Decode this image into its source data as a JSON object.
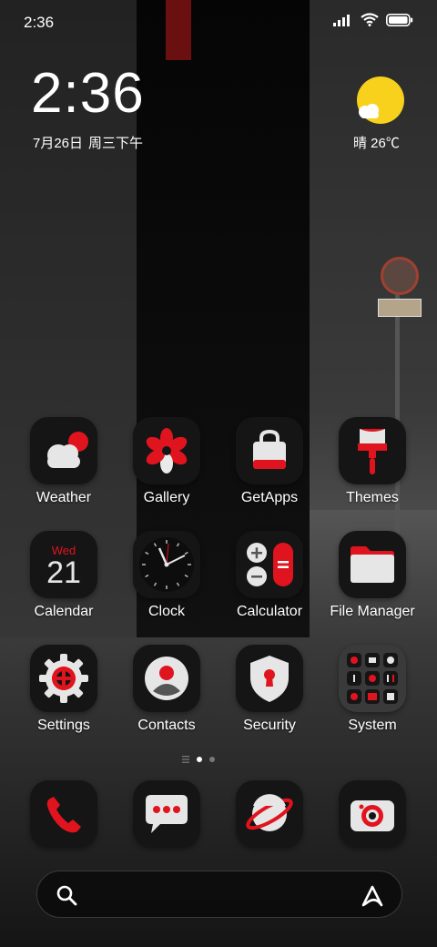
{
  "status_bar": {
    "time": "2:36"
  },
  "clock_widget": {
    "time": "2:36",
    "date": "7月26日",
    "weekday_period": "周三下午"
  },
  "weather_widget": {
    "text": "晴 26℃",
    "icon": "sunny-partly-cloudy-icon"
  },
  "apps": [
    {
      "label": "Weather",
      "icon": "weather-cloud-icon"
    },
    {
      "label": "Gallery",
      "icon": "gallery-flower-icon"
    },
    {
      "label": "GetApps",
      "icon": "shopping-bag-icon"
    },
    {
      "label": "Themes",
      "icon": "paint-brush-icon"
    },
    {
      "label": "Calendar",
      "icon": "calendar-icon",
      "badge_day": "Wed",
      "badge_date": "21"
    },
    {
      "label": "Clock",
      "icon": "clock-icon"
    },
    {
      "label": "Calculator",
      "icon": "calculator-icon"
    },
    {
      "label": "File Manager",
      "icon": "folder-icon"
    },
    {
      "label": "Settings",
      "icon": "gear-icon"
    },
    {
      "label": "Contacts",
      "icon": "contact-person-icon"
    },
    {
      "label": "Security",
      "icon": "shield-lock-icon"
    },
    {
      "label": "System",
      "icon": "system-folder-icon"
    }
  ],
  "dock": [
    {
      "name": "phone",
      "icon": "phone-icon"
    },
    {
      "name": "messages",
      "icon": "chat-bubble-icon"
    },
    {
      "name": "browser",
      "icon": "planet-icon"
    },
    {
      "name": "camera",
      "icon": "camera-icon"
    }
  ],
  "page_indicator": {
    "pages": 2,
    "current": 1
  },
  "colors": {
    "accent": "#e0141e",
    "tile": "#151515",
    "sun": "#f7d11c"
  }
}
